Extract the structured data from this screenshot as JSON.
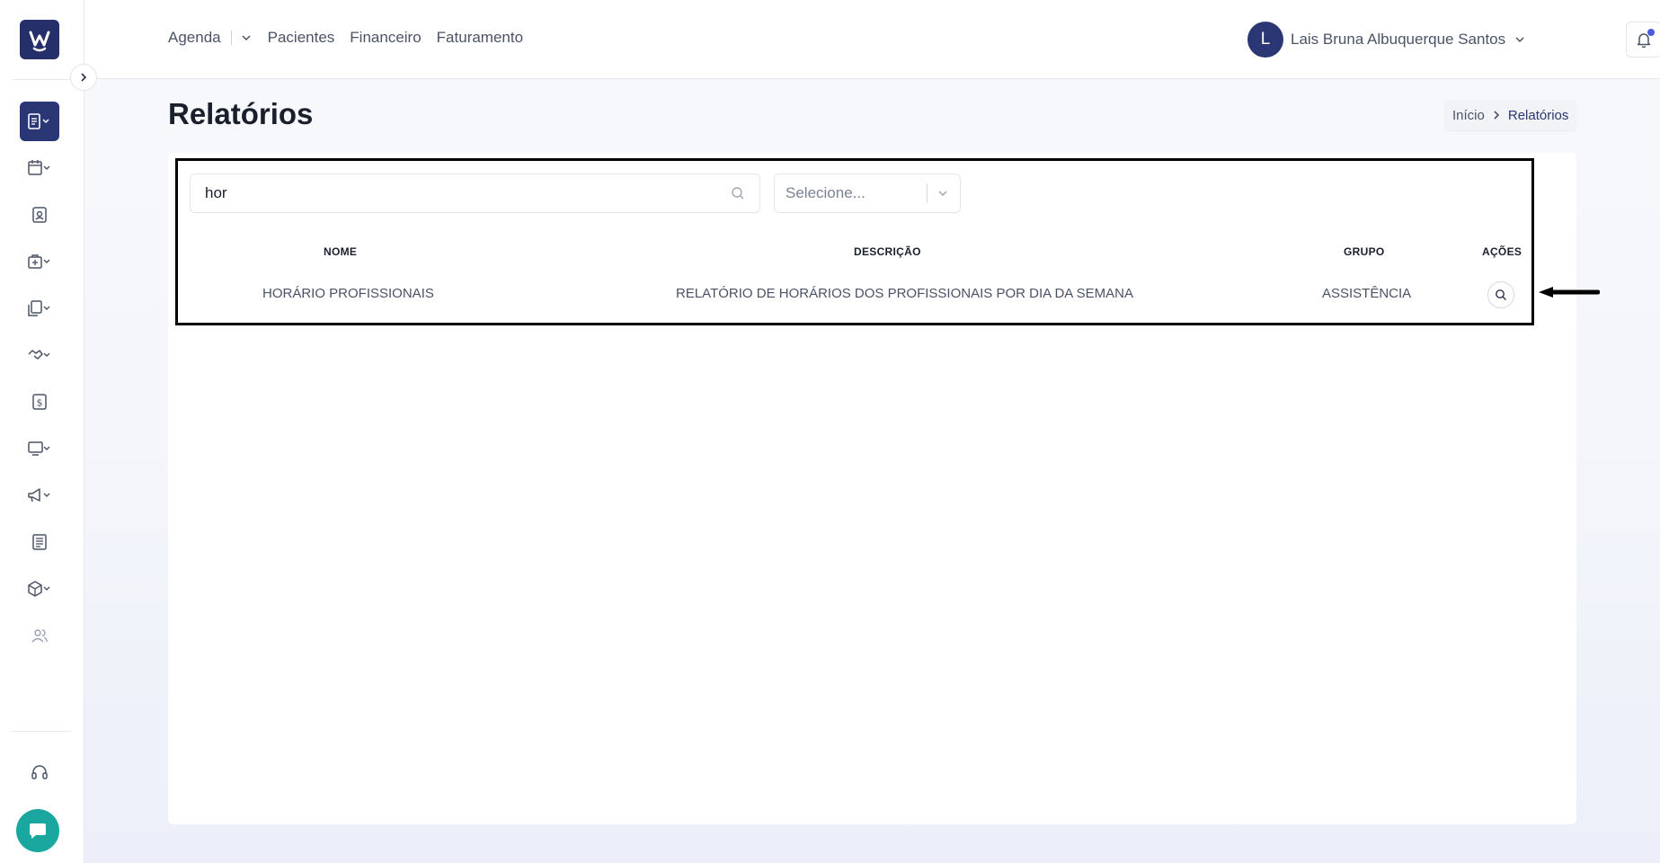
{
  "header": {
    "nav": [
      {
        "label": "Agenda"
      },
      {
        "label": "Pacientes"
      },
      {
        "label": "Financeiro"
      },
      {
        "label": "Faturamento"
      }
    ],
    "user": {
      "initial": "L",
      "name": "Lais Bruna Albuquerque Santos"
    }
  },
  "page": {
    "title": "Relatórios",
    "breadcrumb": {
      "home": "Início",
      "current": "Relatórios"
    }
  },
  "filters": {
    "search_value": "hor",
    "select_placeholder": "Selecione..."
  },
  "table": {
    "columns": [
      "NOME",
      "DESCRIÇÃO",
      "GRUPO",
      "AÇÕES"
    ],
    "rows": [
      {
        "nome": "HORÁRIO PROFISSIONAIS",
        "descricao": "RELATÓRIO DE HORÁRIOS DOS PROFISSIONAIS POR DIA DA SEMANA",
        "grupo": "ASSISTÊNCIA"
      }
    ]
  },
  "sidebar": {
    "items": [
      "reports-icon",
      "calendar-icon",
      "patient-card-icon",
      "medical-kit-icon",
      "documents-icon",
      "handshake-icon",
      "finance-icon",
      "monitor-icon",
      "megaphone-icon",
      "newspaper-icon",
      "package-icon",
      "users-icon",
      "headset-icon"
    ]
  },
  "colors": {
    "primary": "#2b3674",
    "accent": "#4a5bdc",
    "chat": "#19a7a0"
  }
}
